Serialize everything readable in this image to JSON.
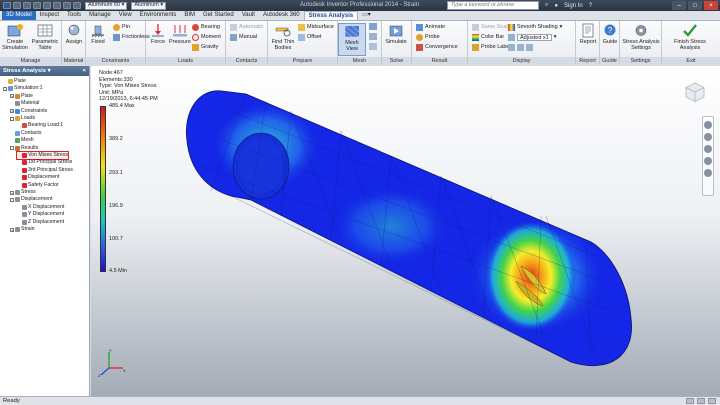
{
  "titlebar": {
    "material_combo": "Aluminum 60",
    "appearance_combo": "Aluminum",
    "app_title": "Autodesk Inventor Professional 2014 - Strain",
    "search_placeholder": "Type a keyword or phrase",
    "sign_in": "Sign In"
  },
  "tabs": [
    "3D Model",
    "Inspect",
    "Tools",
    "Manage",
    "View",
    "Environments",
    "BIM",
    "Get Started",
    "Vault",
    "Autodesk 360",
    "Stress Analysis"
  ],
  "ribbon": {
    "manage": {
      "title": "Manage",
      "create_simulation": "Create Simulation",
      "parametric_table": "Parametric Table"
    },
    "material": {
      "title": "Material",
      "assign": "Assign"
    },
    "constraints": {
      "title": "Constraints",
      "fixed": "Fixed",
      "pin": "Pin",
      "frictionless": "Frictionless"
    },
    "loads": {
      "title": "Loads",
      "force": "Force",
      "pressure": "Pressure",
      "bearing": "Bearing",
      "moment": "Moment",
      "gravity": "Gravity"
    },
    "contacts": {
      "title": "Contacts",
      "automatic": "Automatic",
      "manual": "Manual"
    },
    "prepare": {
      "title": "Prepare",
      "find_thin_bodies": "Find Thin Bodies",
      "midsurface": "Midsurface",
      "offset": "Offset"
    },
    "mesh": {
      "title": "Mesh",
      "mesh_view": "Mesh View"
    },
    "solve": {
      "title": "Solve",
      "simulate": "Simulate"
    },
    "result": {
      "title": "Result",
      "animate": "Animate",
      "probe": "Probe",
      "convergence": "Convergence"
    },
    "display": {
      "title": "Display",
      "same_scale": "Same Scale",
      "color_bar": "Color Bar",
      "probe_labels": "Probe Labels",
      "smooth_shading": "Smooth Shading",
      "adjusted": "Adjusted x1"
    },
    "report": {
      "title": "Report",
      "report": "Report"
    },
    "guide": {
      "title": "Guide",
      "guide": "Guide"
    },
    "settings": {
      "title": "Settings",
      "stress_analysis_settings": "Stress Analysis Settings"
    },
    "exit": {
      "title": "Exit",
      "finish": "Finish Stress Analysis"
    }
  },
  "browser": {
    "header": "Stress Analysis",
    "close": "×",
    "nodes": [
      {
        "label": "Plate",
        "depth": 0,
        "exp": ""
      },
      {
        "label": "Simulation:1",
        "depth": 0,
        "exp": "-"
      },
      {
        "label": "Plate",
        "depth": 1,
        "exp": "+"
      },
      {
        "label": "Material",
        "depth": 1,
        "exp": ""
      },
      {
        "label": "Constraints",
        "depth": 1,
        "exp": "+"
      },
      {
        "label": "Loads",
        "depth": 1,
        "exp": "-"
      },
      {
        "label": "Bearing Load:1",
        "depth": 2,
        "exp": ""
      },
      {
        "label": "Contacts",
        "depth": 1,
        "exp": ""
      },
      {
        "label": "Mesh",
        "depth": 1,
        "exp": ""
      },
      {
        "label": "Results",
        "depth": 1,
        "exp": "-"
      },
      {
        "label": "Von Mises Stress",
        "depth": 2,
        "exp": "",
        "sel": true
      },
      {
        "label": "1st Principal Stress",
        "depth": 2,
        "exp": ""
      },
      {
        "label": "3rd Principal Stress",
        "depth": 2,
        "exp": ""
      },
      {
        "label": "Displacement",
        "depth": 2,
        "exp": ""
      },
      {
        "label": "Safety Factor",
        "depth": 2,
        "exp": ""
      },
      {
        "label": "Stress",
        "depth": 1,
        "exp": "+"
      },
      {
        "label": "Displacement",
        "depth": 1,
        "exp": "-"
      },
      {
        "label": "X Displacement",
        "depth": 2,
        "exp": ""
      },
      {
        "label": "Y Displacement",
        "depth": 2,
        "exp": ""
      },
      {
        "label": "Z Displacement",
        "depth": 2,
        "exp": ""
      },
      {
        "label": "Strain",
        "depth": 1,
        "exp": "+"
      }
    ]
  },
  "legend": {
    "node": "Node:467",
    "elements": "Elements:330",
    "type": "Type: Von Mises Stress",
    "unit": "Unit: MPa",
    "date": "12/19/2013, 6:44:45 PM",
    "max_label": "485.4 Max",
    "v1": "389.2",
    "v2": "293.1",
    "v3": "196.9",
    "v4": "100.7",
    "min_label": "4.5 Min"
  },
  "status": "Ready",
  "colors": {
    "accent": "#2b6cc4",
    "part_blue": "#1426e6"
  }
}
